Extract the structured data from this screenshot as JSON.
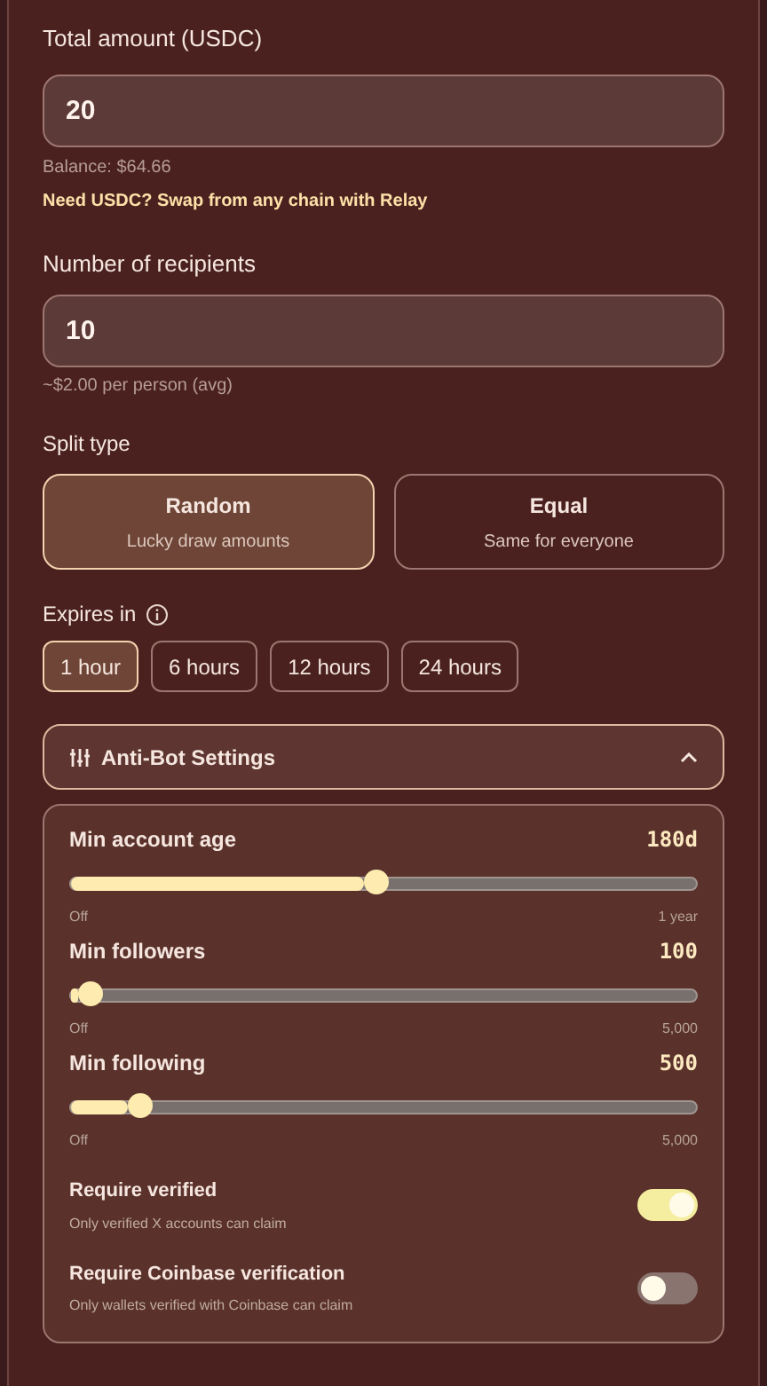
{
  "amount": {
    "label": "Total amount (USDC)",
    "value": "20",
    "balance": "Balance: $64.66",
    "swap_link": "Need USDC? Swap from any chain with Relay"
  },
  "recipients": {
    "label": "Number of recipients",
    "value": "10",
    "hint": "~$2.00 per person (avg)"
  },
  "split": {
    "label": "Split type",
    "options": [
      {
        "title": "Random",
        "subtitle": "Lucky draw amounts",
        "selected": true
      },
      {
        "title": "Equal",
        "subtitle": "Same for everyone",
        "selected": false
      }
    ]
  },
  "expires": {
    "label": "Expires in",
    "options": [
      {
        "label": "1 hour",
        "selected": true
      },
      {
        "label": "6 hours",
        "selected": false
      },
      {
        "label": "12 hours",
        "selected": false
      },
      {
        "label": "24 hours",
        "selected": false
      }
    ]
  },
  "anti_bot": {
    "title": "Anti-Bot Settings",
    "expanded": true,
    "sliders": [
      {
        "label": "Min account age",
        "reading": "180d",
        "level": 0.49,
        "min": "Off",
        "max": "1 year"
      },
      {
        "label": "Min followers",
        "reading": "100",
        "level": 0.03,
        "min": "Off",
        "max": "5,000"
      },
      {
        "label": "Min following",
        "reading": "500",
        "level": 0.11,
        "min": "Off",
        "max": "5,000"
      }
    ],
    "toggles": [
      {
        "label": "Require verified",
        "description": "Only verified X accounts can claim",
        "on": true
      },
      {
        "label": "Require Coinbase verification",
        "description": "Only wallets verified with Coinbase can claim",
        "on": false
      }
    ]
  }
}
